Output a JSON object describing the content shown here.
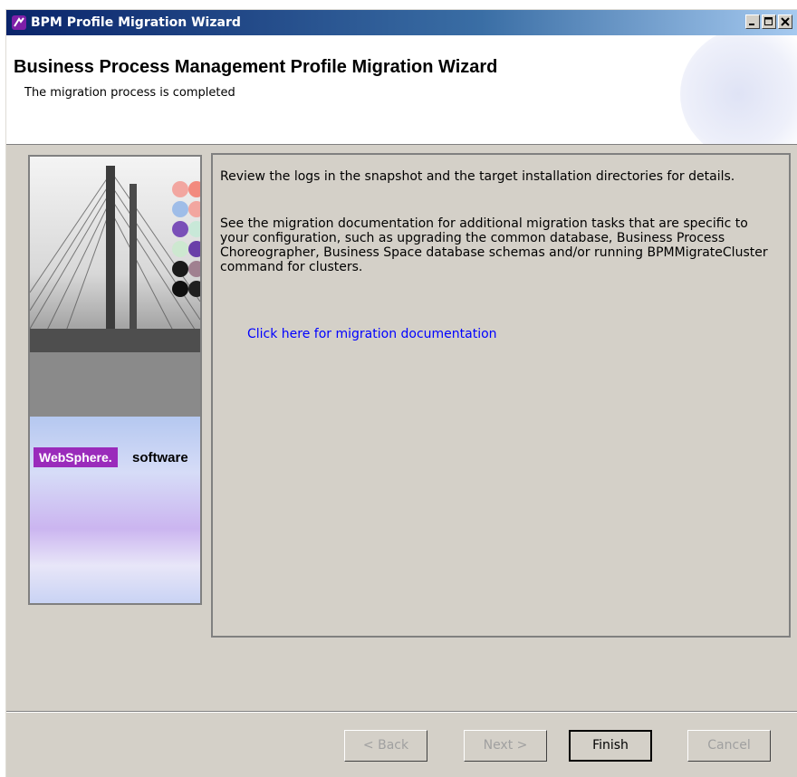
{
  "window": {
    "title": "BPM Profile Migration Wizard",
    "controls": [
      "minimize-icon",
      "maximize-icon",
      "close-icon"
    ]
  },
  "header": {
    "title": "Business Process Management Profile Migration Wizard",
    "subtitle": "The migration process is completed"
  },
  "banner": {
    "brand": "WebSphere.",
    "suffix": "software"
  },
  "content": {
    "para1": "Review the logs in the snapshot and the target installation directories for details.",
    "para2": "See the migration documentation for additional migration tasks that are specific to your configuration, such as upgrading the common database, Business Process Choreographer, Business Space database schemas and/or running BPMMigrateCluster command for clusters.",
    "link": "Click here for migration documentation"
  },
  "buttons": {
    "back": "< Back",
    "next": "Next >",
    "finish": "Finish",
    "cancel": "Cancel"
  },
  "colors": {
    "titlebar_start": "#0a246a",
    "link": "#0000ff",
    "brand_purple": "#9a2bbb",
    "dialog_bg": "#d4d0c8"
  }
}
